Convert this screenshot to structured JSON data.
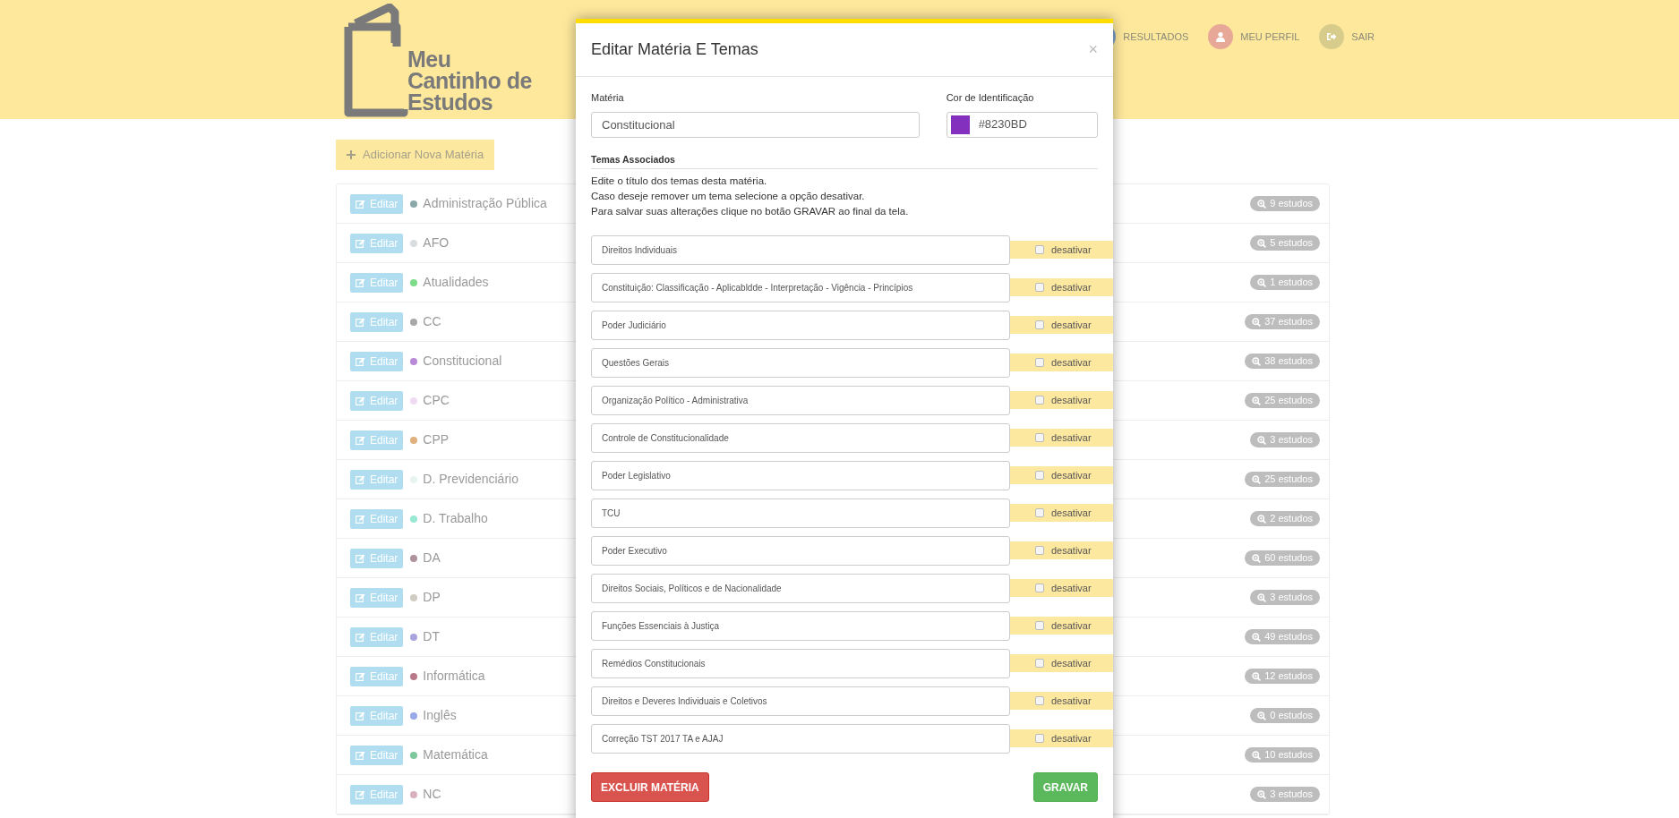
{
  "header": {
    "logo": "Meu Cantinho de Estudos",
    "nav": [
      {
        "label": "RESULTADOS",
        "kind": "chart"
      },
      {
        "label": "MEU PERFIL",
        "kind": "user"
      },
      {
        "label": "SAIR",
        "kind": "exit"
      }
    ]
  },
  "add_button": "Adicionar Nova Matéria",
  "materias": [
    {
      "name": "Administração Pública",
      "color": "#8aa8a8",
      "edit": "Editar",
      "count": "9 estudos"
    },
    {
      "name": "AFO",
      "color": "#d8dde0",
      "edit": "Editar",
      "count": "5 estudos"
    },
    {
      "name": "Atualidades",
      "color": "#7ddc8a",
      "edit": "Editar",
      "count": "1 estudos"
    },
    {
      "name": "CC",
      "color": "#a8a8a8",
      "edit": "Editar",
      "count": "37 estudos"
    },
    {
      "name": "Constitucional",
      "color": "#b98ad8",
      "edit": "Editar",
      "count": "38 estudos"
    },
    {
      "name": "CPC",
      "color": "#efdcf2",
      "edit": "Editar",
      "count": "25 estudos"
    },
    {
      "name": "CPP",
      "color": "#e0b07e",
      "edit": "Editar",
      "count": "3 estudos"
    },
    {
      "name": "D. Previdenciário",
      "color": "#e8f4ee",
      "edit": "Editar",
      "count": "25 estudos"
    },
    {
      "name": "D. Trabalho",
      "color": "#98e8d4",
      "edit": "Editar",
      "count": "2 estudos"
    },
    {
      "name": "DA",
      "color": "#b0929a",
      "edit": "Editar",
      "count": "60 estudos"
    },
    {
      "name": "DP",
      "color": "#d0ccc4",
      "edit": "Editar",
      "count": "3 estudos"
    },
    {
      "name": "DT",
      "color": "#aaa4dc",
      "edit": "Editar",
      "count": "49 estudos"
    },
    {
      "name": "Informática",
      "color": "#b87a88",
      "edit": "Editar",
      "count": "12 estudos"
    },
    {
      "name": "Inglês",
      "color": "#98aae8",
      "edit": "Editar",
      "count": "0 estudos"
    },
    {
      "name": "Matemática",
      "color": "#7ec89e",
      "edit": "Editar",
      "count": "10 estudos"
    },
    {
      "name": "NC",
      "color": "#d8b0c0",
      "edit": "Editar",
      "count": "3 estudos"
    }
  ],
  "modal": {
    "title": "Editar Matéria E Temas",
    "close": "×",
    "materia": {
      "label": "Matéria",
      "value": "Constitucional"
    },
    "cor": {
      "label": "Cor de Identificação",
      "value": "#8230BD",
      "color": "#8230bd"
    },
    "section": "Temas Associados",
    "instructions": [
      "Edite o título dos temas desta matéria.",
      "Caso deseje remover um tema selecione a opção desativar.",
      "Para salvar suas alterações clique no botão GRAVAR ao final da tela."
    ],
    "temas": [
      {
        "title": "Direitos Individuais",
        "toggle": "desativar",
        "checked": false
      },
      {
        "title": "Constituição: Classificação - Aplicabldde - Interpretação - Vigência - Princípios",
        "toggle": "desativar",
        "checked": false
      },
      {
        "title": "Poder Judiciário",
        "toggle": "desativar",
        "checked": false
      },
      {
        "title": "Questões Gerais",
        "toggle": "desativar",
        "checked": false
      },
      {
        "title": "Organização Político - Administrativa",
        "toggle": "desativar",
        "checked": false
      },
      {
        "title": "Controle de Constitucionalidade",
        "toggle": "desativar",
        "checked": false
      },
      {
        "title": "Poder Legislativo",
        "toggle": "desativar",
        "checked": false
      },
      {
        "title": "TCU",
        "toggle": "desativar",
        "checked": false
      },
      {
        "title": "Poder Executivo",
        "toggle": "desativar",
        "checked": false
      },
      {
        "title": "Direitos Sociais, Políticos e de Nacionalidade",
        "toggle": "desativar",
        "checked": false
      },
      {
        "title": "Funções Essenciais à Justiça",
        "toggle": "desativar",
        "checked": false
      },
      {
        "title": "Remédios Constitucionais",
        "toggle": "desativar",
        "checked": false
      },
      {
        "title": "Direitos e Deveres Individuais e Coletivos",
        "toggle": "desativar",
        "checked": false
      },
      {
        "title": "Correção TST 2017 TA e AJAJ",
        "toggle": "desativar",
        "checked": false
      }
    ],
    "delete_button": "EXCLUIR MATÉRIA",
    "save_button": "GRAVAR"
  }
}
